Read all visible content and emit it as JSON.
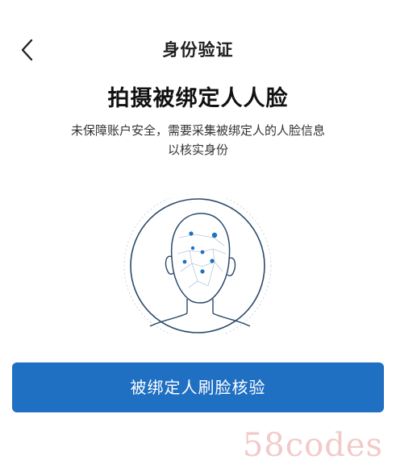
{
  "header": {
    "title": "身份验证",
    "back_icon": "chevron-left-icon"
  },
  "main": {
    "title": "拍摄被绑定人人脸",
    "description_line1": "未保障账户安全，需要采集被绑定人的人脸信息",
    "description_line2": "以核实身份",
    "illustration_icon": "face-scan-icon"
  },
  "action": {
    "verify_label": "被绑定人刷脸核验"
  },
  "watermark": {
    "text": "58codes"
  },
  "colors": {
    "accent": "#1f6fc2",
    "face_line": "#2a4a6a",
    "dot": "#1f6fc2",
    "watermark": "#f2c4c4"
  }
}
